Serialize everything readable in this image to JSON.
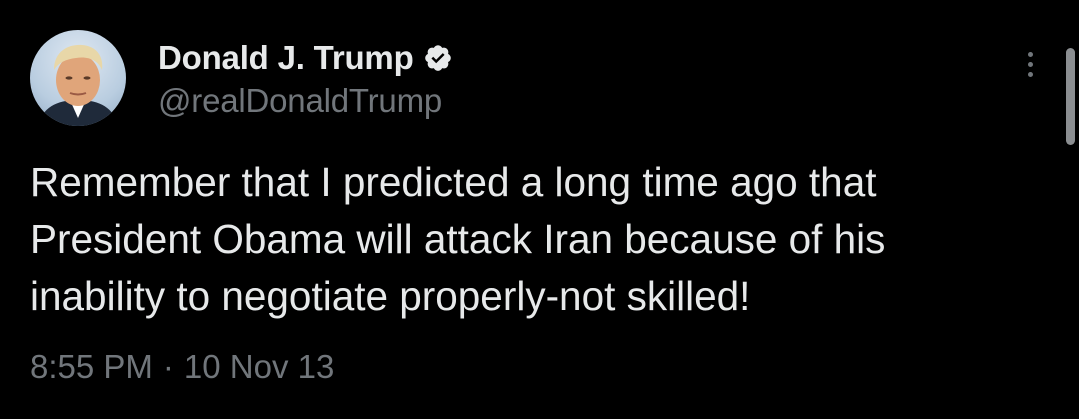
{
  "author": {
    "display_name": "Donald J. Trump",
    "handle": "@realDonaldTrump",
    "verified": true,
    "verified_color": "#e7e9ea"
  },
  "tweet": {
    "text_lines": [
      "Remember that I predicted a long time ago that",
      "President Obama will attack Iran because of his",
      "inability to negotiate properly-not skilled!"
    ],
    "time": "8:55 PM",
    "separator": "·",
    "date": "10 Nov 13"
  },
  "icons": {
    "verified": "verified-badge-icon",
    "more": "more-options-icon",
    "avatar": "profile-photo"
  },
  "colors": {
    "background": "#000000",
    "primary_text": "#e7e9ea",
    "secondary_text": "#71767b"
  }
}
